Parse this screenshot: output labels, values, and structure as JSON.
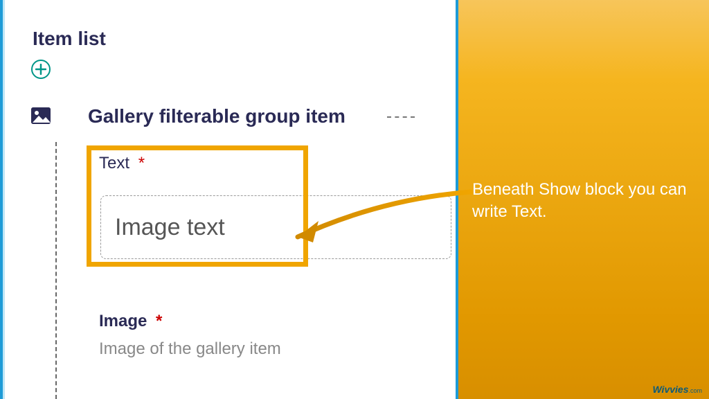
{
  "section": {
    "title": "Item list"
  },
  "item": {
    "title": "Gallery filterable group item",
    "fields": {
      "text": {
        "label": "Text",
        "required_mark": "*",
        "value": "Image text"
      },
      "image": {
        "label": "Image",
        "required_mark": "*",
        "description": "Image of the gallery item"
      }
    }
  },
  "annotation": {
    "text": "Beneath Show block you can write Text."
  },
  "colors": {
    "highlight": "#f0a500",
    "accent": "#1e9bd7",
    "panel_top": "#f7c55a",
    "panel_bottom": "#d88f00"
  },
  "brand": {
    "name": "Wivvies",
    "domain": ".com"
  }
}
